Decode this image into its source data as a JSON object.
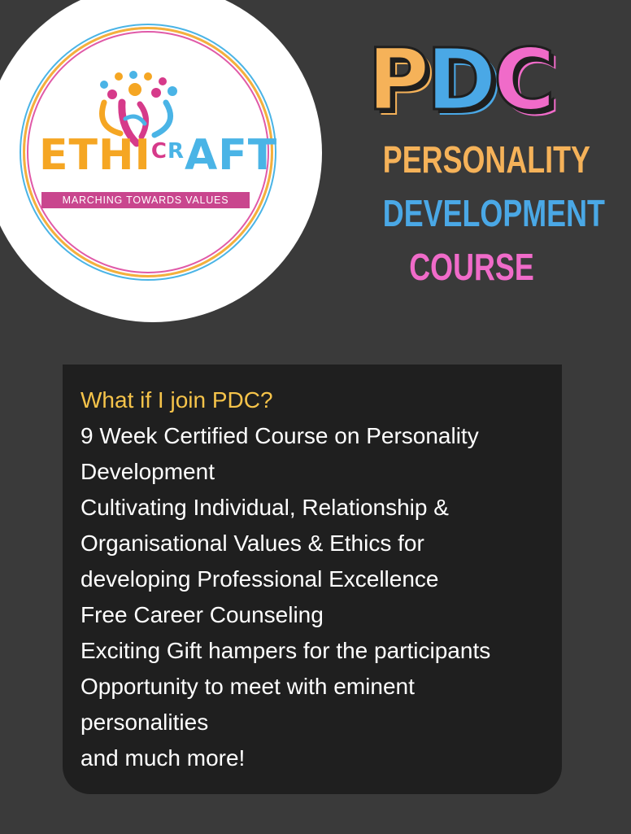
{
  "logo": {
    "word_e": "ETHI",
    "word_c": "C",
    "word_r": "R",
    "word_aft": "AFT",
    "tagline": "MARCHING TOWARDS VALUES"
  },
  "brand": {
    "letters": [
      "P",
      "D",
      "C"
    ],
    "title_lines": [
      "PERSONALITY",
      "DEVELOPMENT",
      "COURSE"
    ]
  },
  "colors": {
    "orange": "#f5b259",
    "blue": "#4aa8e6",
    "pink": "#f06bc9",
    "question": "#f5c34a",
    "background": "#3a3a3a",
    "card": "#1f1f1f"
  },
  "card": {
    "question": "What if I join PDC?",
    "lines": [
      "9 Week Certified Course on Personality",
      "Development",
      "Cultivating Individual, Relationship &",
      "Organisational Values & Ethics for",
      "developing Professional Excellence",
      "Free Career Counseling",
      "Exciting Gift hampers for the participants",
      "Opportunity to meet with eminent",
      "personalities",
      "and much more!"
    ]
  }
}
